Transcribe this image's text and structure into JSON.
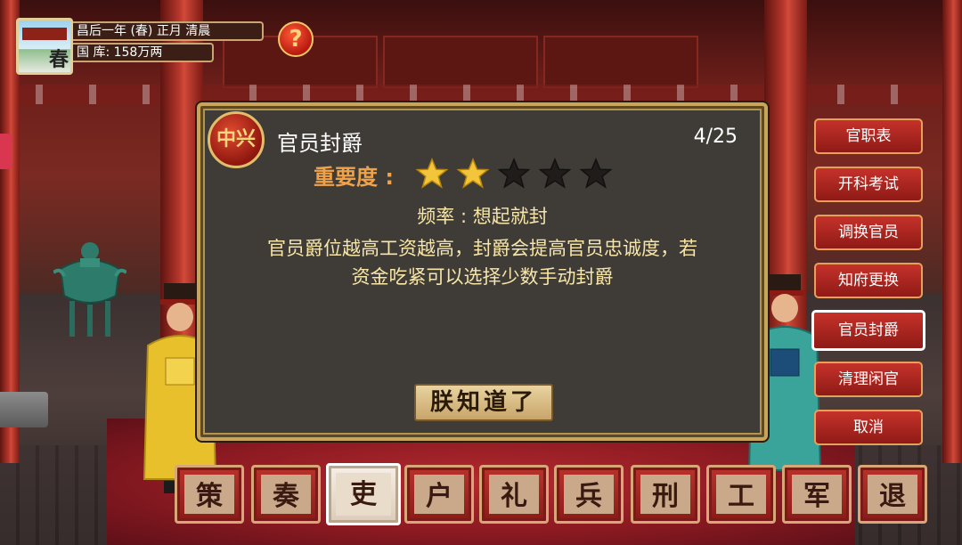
{
  "status": {
    "season_glyph": "春",
    "date_text": "昌后一年 (春) 正月 清晨",
    "treasury_text": "国 库: 158万两",
    "help_label": "?"
  },
  "dialog": {
    "seal_text": "中兴",
    "title": "官员封爵",
    "counter": "4/25",
    "importance_label": "重要度 :",
    "importance_rating": 2,
    "importance_max": 5,
    "frequency_text": "频率 : 想起就封",
    "description_lines": [
      "官员爵位越高工资越高，封爵会提高官员忠诚度，若",
      "资金吃紧可以选择少数手动封爵"
    ],
    "ok_label": "朕知道了"
  },
  "side_menu": [
    {
      "label": "官职表",
      "active": false
    },
    {
      "label": "开科考试",
      "active": false
    },
    {
      "label": "调换官员",
      "active": false
    },
    {
      "label": "知府更换",
      "active": false
    },
    {
      "label": "官员封爵",
      "active": true
    },
    {
      "label": "清理闲官",
      "active": false
    },
    {
      "label": "取消",
      "active": false
    }
  ],
  "bottom_tabs": [
    {
      "label": "策",
      "active": false
    },
    {
      "label": "奏",
      "active": false
    },
    {
      "label": "吏",
      "active": true
    },
    {
      "label": "户",
      "active": false
    },
    {
      "label": "礼",
      "active": false
    },
    {
      "label": "兵",
      "active": false
    },
    {
      "label": "刑",
      "active": false
    },
    {
      "label": "工",
      "active": false
    },
    {
      "label": "军",
      "active": false
    },
    {
      "label": "退",
      "active": false
    }
  ],
  "colors": {
    "star_filled": "#f2c53a",
    "star_empty": "#1f1c1a",
    "importance_text": "#f0a248",
    "body_text": "#f7e6a8"
  }
}
